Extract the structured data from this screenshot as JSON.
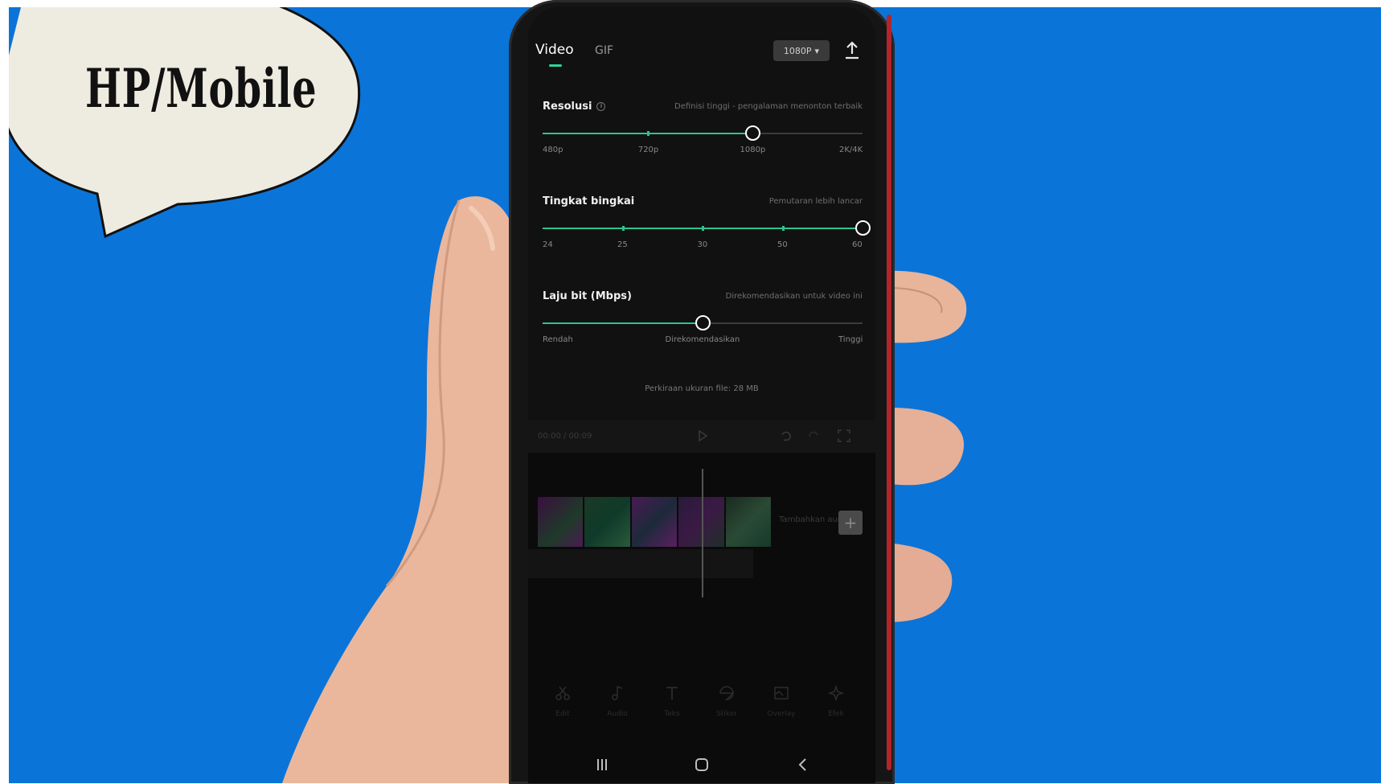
{
  "bubble": {
    "text": "HP/Mobile"
  },
  "header": {
    "tabs": [
      {
        "label": "Video",
        "active": true
      },
      {
        "label": "GIF",
        "active": false
      }
    ],
    "resolution_button": "1080P",
    "export_icon": "upload-icon"
  },
  "settings": {
    "resolution": {
      "title": "Resolusi",
      "hint": "Definisi tinggi - pengalaman menonton terbaik",
      "labels": [
        "480p",
        "720p",
        "1080p",
        "2K/4K"
      ],
      "selected_index": 2,
      "selected_fraction": 0.657
    },
    "framerate": {
      "title": "Tingkat bingkai",
      "hint": "Pemutaran lebih lancar",
      "labels": [
        "24",
        "25",
        "30",
        "50",
        "60"
      ],
      "selected_index": 4,
      "selected_fraction": 1.0
    },
    "bitrate": {
      "title": "Laju bit (Mbps)",
      "hint": "Direkomendasikan untuk video ini",
      "labels": [
        "Rendah",
        "Direkomendasikan",
        "Tinggi"
      ],
      "selected_fraction": 0.5
    }
  },
  "estimate": "Perkiraan ukuran file: 28 MB",
  "timeline": {
    "time": "00:00 / 00:09",
    "add_audio": "Tambahkan audio"
  },
  "tools": [
    {
      "label": "Edit",
      "icon": "scissors-icon"
    },
    {
      "label": "Audio",
      "icon": "music-note-icon"
    },
    {
      "label": "Teks",
      "icon": "text-icon"
    },
    {
      "label": "Stiker",
      "icon": "sticker-icon"
    },
    {
      "label": "Overlay",
      "icon": "overlay-icon"
    },
    {
      "label": "Efek",
      "icon": "effects-icon"
    }
  ],
  "navbar": [
    "recents-icon",
    "home-icon",
    "back-icon"
  ],
  "colors": {
    "background": "#0b74d8",
    "accent": "#2bc494",
    "bubble_fill": "#eeebe0"
  }
}
